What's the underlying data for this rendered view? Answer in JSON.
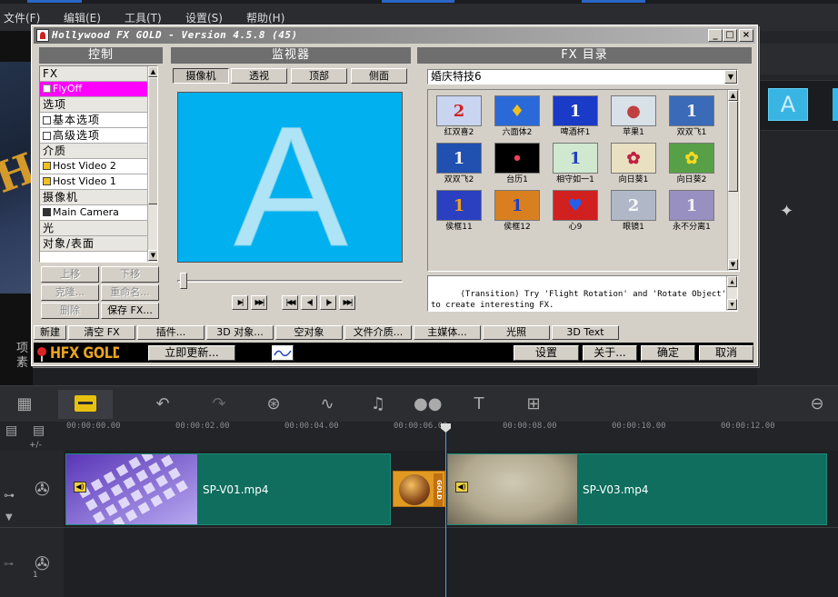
{
  "host": {
    "menu": [
      "文件(F)",
      "编辑(E)",
      "工具(T)",
      "设置(S)",
      "帮助(H)"
    ],
    "side_text_1": "项",
    "side_text_2": "素",
    "timecodes": [
      "00:00:00.00",
      "00:00:02.00",
      "00:00:04.00",
      "00:00:06.00",
      "00:00:08.00",
      "00:00:10.00",
      "00:00:12.00"
    ],
    "clips": [
      {
        "name": "SP-V01.mp4"
      },
      {
        "name": "SP-V03.mp4"
      }
    ],
    "transition_badge": "GOLD",
    "track_label": "+/-",
    "track_number": "1",
    "colors": {
      "clip": "#0f6e5e",
      "playhead": "#4aa0ff",
      "active_tool": "#e8c010"
    }
  },
  "dialog": {
    "title": "Hollywood FX GOLD - Version 4.5.8 (45)",
    "window_buttons": [
      "_",
      "□",
      "×"
    ],
    "panels": {
      "control": "控制",
      "monitor": "监视器",
      "catalog": "FX 目录"
    },
    "control_items": [
      {
        "label": "FX",
        "kind": "cat"
      },
      {
        "label": "FlyOff",
        "kind": "sel",
        "icon": "grid-icon"
      },
      {
        "label": "选项",
        "kind": "cat"
      },
      {
        "label": "基本选项",
        "kind": "item",
        "icon": "expand-icon"
      },
      {
        "label": "高级选项",
        "kind": "item",
        "icon": "expand-icon"
      },
      {
        "label": "介质",
        "kind": "cat"
      },
      {
        "label": "Host Video 2",
        "kind": "item",
        "icon": "film-icon"
      },
      {
        "label": "Host Video 1",
        "kind": "item",
        "icon": "film-icon"
      },
      {
        "label": "摄像机",
        "kind": "cat"
      },
      {
        "label": "Main Camera",
        "kind": "item",
        "icon": "camera-icon"
      },
      {
        "label": "光",
        "kind": "cat"
      },
      {
        "label": "对象/表面",
        "kind": "cat"
      }
    ],
    "control_buttons": [
      "上移",
      "下移",
      "克隆...",
      "重命名...",
      "删除",
      "保存 FX..."
    ],
    "monitor_tabs": [
      "摄像机",
      "透视",
      "顶部",
      "侧面"
    ],
    "preview_letter": "A",
    "transport": [
      "▶|",
      "▶▶|",
      "|◀◀",
      "◀|",
      "|▶",
      "▶▶|"
    ],
    "catalog_selected": "婚庆特技6",
    "fx_items": [
      {
        "label": "红双喜2",
        "bg": "#c8d4f0",
        "glyph": "2",
        "fg": "#d02020"
      },
      {
        "label": "六面体2",
        "bg": "#2a6ad8",
        "glyph": "♦",
        "fg": "#f0c020"
      },
      {
        "label": "啤酒杯1",
        "bg": "#1a3ac8",
        "glyph": "1",
        "fg": "#f8f8f8"
      },
      {
        "label": "苹果1",
        "bg": "#d8e0e8",
        "glyph": "●",
        "fg": "#c04040"
      },
      {
        "label": "双双飞1",
        "bg": "#3a6ab8",
        "glyph": "1",
        "fg": "#f0f0f0"
      },
      {
        "label": "双双飞2",
        "bg": "#2050b0",
        "glyph": "1",
        "fg": "#f0f0f0"
      },
      {
        "label": "台历1",
        "bg": "#000000",
        "glyph": "•",
        "fg": "#f04060"
      },
      {
        "label": "相守如一1",
        "bg": "#d0e8d0",
        "glyph": "1",
        "fg": "#2040c0"
      },
      {
        "label": "向日葵1",
        "bg": "#e8e0c0",
        "glyph": "✿",
        "fg": "#c02040"
      },
      {
        "label": "向日葵2",
        "bg": "#58a048",
        "glyph": "✿",
        "fg": "#f8d820"
      },
      {
        "label": "侯框11",
        "bg": "#2a40c0",
        "glyph": "1",
        "fg": "#f0a020"
      },
      {
        "label": "侯框12",
        "bg": "#d88020",
        "glyph": "1",
        "fg": "#2040c0"
      },
      {
        "label": "心9",
        "bg": "#d02020",
        "glyph": "♥",
        "fg": "#2060f0"
      },
      {
        "label": "眼镜1",
        "bg": "#b0b8c8",
        "glyph": "2",
        "fg": "#f8f8f8"
      },
      {
        "label": "永不分离1",
        "bg": "#9890c0",
        "glyph": "1",
        "fg": "#f0f0f0"
      }
    ],
    "description": "(Transition) Try 'Flight Rotation' and 'Rotate Object' to create interesting FX.",
    "bottom_buttons": [
      "新建",
      "清空 FX",
      "插件...",
      "3D 对象...",
      "空对象",
      "文件介质...",
      "主媒体...",
      "光照",
      "3D Text"
    ],
    "logo": "HFX GOLD",
    "update_button": "立即更新...",
    "action_buttons": [
      "设置",
      "关于...",
      "确定",
      "取消"
    ],
    "colors": {
      "viewport": "#00b0ef",
      "selected_row": "#ff00ff",
      "panel_header": "#6e6e6e"
    }
  }
}
